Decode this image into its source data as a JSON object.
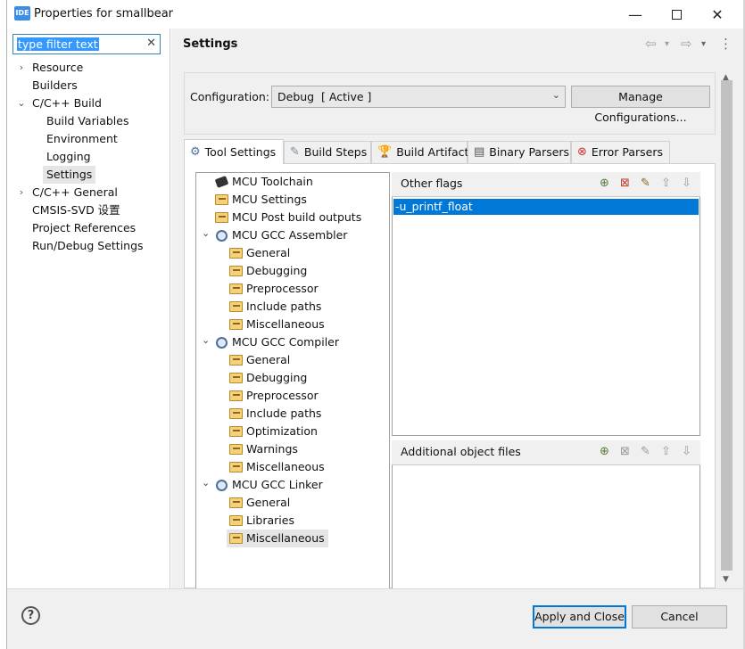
{
  "window": {
    "title": "Properties for smallbear",
    "app_icon": "IDE"
  },
  "filter": {
    "value": "type filter text"
  },
  "nav": {
    "items": [
      {
        "label": "Resource"
      },
      {
        "label": "Builders"
      },
      {
        "label": "C/C++ Build"
      },
      {
        "label": "Build Variables"
      },
      {
        "label": "Environment"
      },
      {
        "label": "Logging"
      },
      {
        "label": "Settings"
      },
      {
        "label": "C/C++ General"
      },
      {
        "label": "CMSIS-SVD 设置"
      },
      {
        "label": "Project References"
      },
      {
        "label": "Run/Debug Settings"
      }
    ],
    "selected": "Settings"
  },
  "header": {
    "title": "Settings"
  },
  "configuration": {
    "label": "Configuration:",
    "value": "Debug  [ Active ]",
    "manage_label": "Manage Configurations..."
  },
  "tabs": [
    {
      "label": "Tool Settings",
      "active": true
    },
    {
      "label": "Build Steps"
    },
    {
      "label": "Build Artifact"
    },
    {
      "label": "Binary Parsers"
    },
    {
      "label": "Error Parsers"
    }
  ],
  "tool_tree": {
    "items": [
      {
        "label": "MCU Toolchain"
      },
      {
        "label": "MCU Settings"
      },
      {
        "label": "MCU Post build outputs"
      },
      {
        "label": "MCU GCC Assembler"
      },
      {
        "label": "General"
      },
      {
        "label": "Debugging"
      },
      {
        "label": "Preprocessor"
      },
      {
        "label": "Include paths"
      },
      {
        "label": "Miscellaneous"
      },
      {
        "label": "MCU GCC Compiler"
      },
      {
        "label": "General"
      },
      {
        "label": "Debugging"
      },
      {
        "label": "Preprocessor"
      },
      {
        "label": "Include paths"
      },
      {
        "label": "Optimization"
      },
      {
        "label": "Warnings"
      },
      {
        "label": "Miscellaneous"
      },
      {
        "label": "MCU GCC Linker"
      },
      {
        "label": "General"
      },
      {
        "label": "Libraries"
      },
      {
        "label": "Miscellaneous"
      }
    ],
    "selected": "Miscellaneous"
  },
  "other_flags": {
    "title": "Other flags",
    "values": [
      "-u_printf_float"
    ]
  },
  "additional_objects": {
    "title": "Additional object files",
    "values": []
  },
  "footer": {
    "help": "?",
    "apply_label": "Apply and Close",
    "cancel_label": "Cancel"
  }
}
